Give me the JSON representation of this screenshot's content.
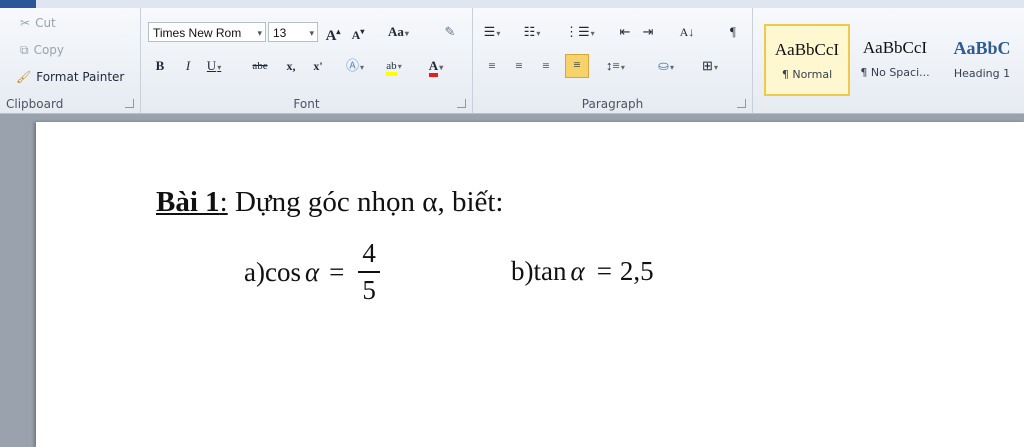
{
  "clipboard": {
    "cut": "Cut",
    "copy": "Copy",
    "format_painter": "Format Painter",
    "label": "Clipboard"
  },
  "font": {
    "name": "Times New Rom",
    "size": "13",
    "grow": "A",
    "shrink": "A",
    "change_case": "Aa",
    "bold": "B",
    "italic": "I",
    "underline": "U",
    "strike": "abe",
    "subscript": "x,",
    "superscript": "x'",
    "font_color": "A",
    "label": "Font"
  },
  "paragraph": {
    "label": "Paragraph",
    "show_marks": "¶"
  },
  "styles": [
    {
      "sample": "AaBbCcI",
      "name": "¶ Normal"
    },
    {
      "sample": "AaBbCcI",
      "name": "¶ No Spaci..."
    },
    {
      "sample": "AaBbC",
      "name": "Heading 1"
    }
  ],
  "document": {
    "title_bold": "Bài 1",
    "title_colon": ":",
    "title_rest": " Dựng góc nhọn α, biết:",
    "part_a_label": "a)",
    "part_a_func": "cos",
    "part_a_var": "α",
    "part_a_eq": "=",
    "part_a_num": "4",
    "part_a_den": "5",
    "part_b_label": "b)",
    "part_b_func": "tan",
    "part_b_var": "α",
    "part_b_eq": "=",
    "part_b_val": "2,5"
  },
  "colors": {
    "accent": "#2b579a",
    "selected_style": "#f0c94a",
    "heading_blue": "#2e5c95"
  }
}
